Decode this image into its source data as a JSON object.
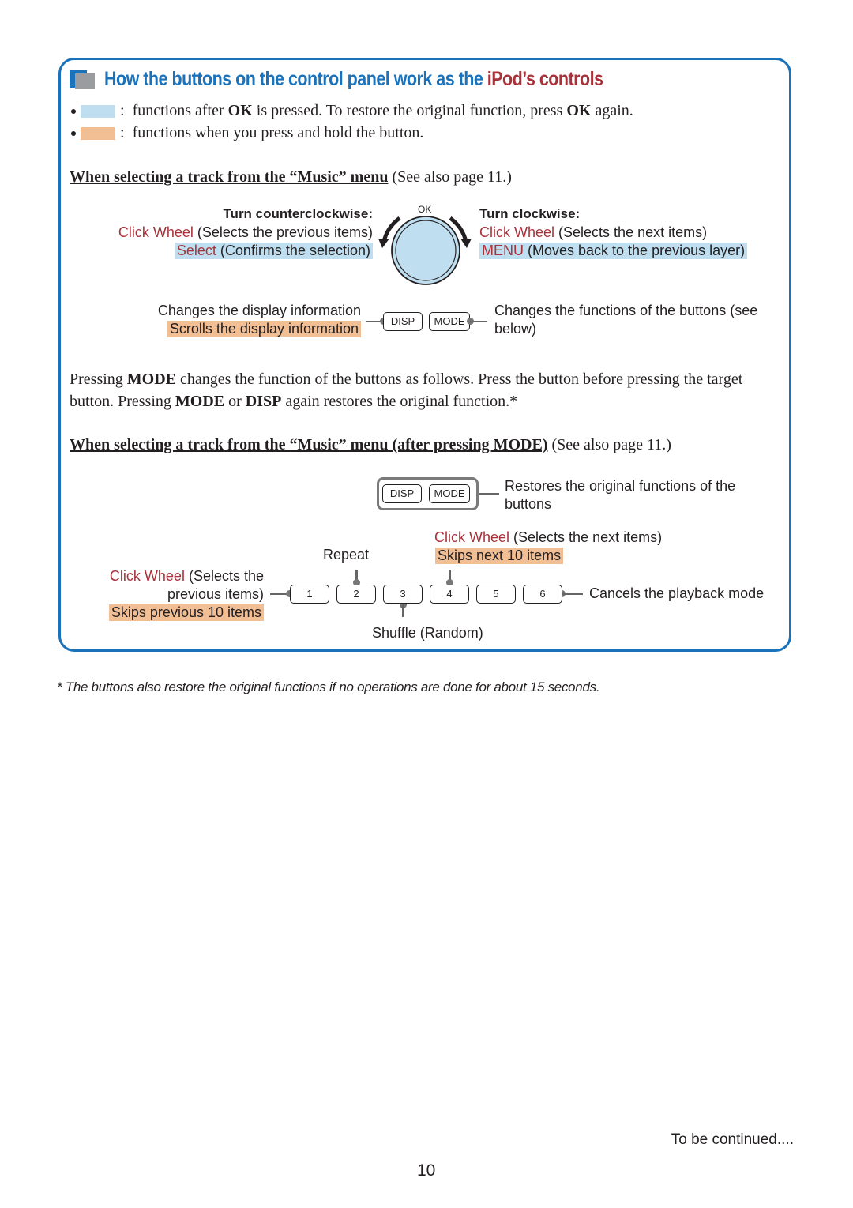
{
  "title": {
    "part1": "How the buttons on the control panel work as the ",
    "part2": "iPod’s controls"
  },
  "legend": [
    {
      "color": "#bfdff0",
      "sep": ":",
      "text_a": "functions after ",
      "bold": "OK",
      "text_b": " is pressed. To restore the original function, press ",
      "bold2": "OK",
      "text_c": " again."
    },
    {
      "color": "#f2bf95",
      "sep": ":",
      "text_a": "functions when you press and hold the button."
    }
  ],
  "section1": {
    "heading": "When selecting a track from the “Music” menu",
    "see_also": "(See also page 11.)"
  },
  "wheel": {
    "ok_label": "OK",
    "ccw": {
      "heading": "Turn counterclockwise:",
      "line1_red": "Click Wheel",
      "line1": " (Selects the previous items)",
      "line2_red": "Select",
      "line2": " (Confirms the selection)"
    },
    "cw": {
      "heading": "Turn clockwise:",
      "line1_red": "Click Wheel",
      "line1": " (Selects the next items)",
      "line2_red": "MENU",
      "line2": " (Moves back to the previous layer)"
    }
  },
  "disp_mode": {
    "disp": "DISP",
    "mode": "MODE",
    "left_line1": "Changes the display information",
    "left_line2": "Scrolls the display information",
    "right_line1": "Changes the functions of the buttons (see",
    "right_line2": "below)"
  },
  "paragraph": {
    "t1": "Pressing ",
    "b1": "MODE",
    "t2": " changes the function of the buttons as follows. Press the button before pressing the target button. Pressing ",
    "b2": "MODE",
    "t3": " or ",
    "b3": "DISP",
    "t4": " again restores the original function.*"
  },
  "section2": {
    "heading": "When selecting a track from the “Music” menu (after pressing MODE)",
    "see_also": "(See also page 11.)"
  },
  "mode_diagram": {
    "disp": "DISP",
    "mode": "MODE",
    "restore_line1": "Restores the original functions of the",
    "restore_line2": "buttons",
    "next_red": "Click Wheel",
    "next": " (Selects the next items)",
    "skip_next": "Skips next 10 items",
    "repeat": "Repeat",
    "prev_red": "Click Wheel",
    "prev_1": " (Selects the",
    "prev_2": "previous items)",
    "skip_prev": "Skips previous 10 items",
    "cancel": "Cancels the playback mode",
    "shuffle": "Shuffle (Random)",
    "buttons": [
      "1",
      "2",
      "3",
      "4",
      "5",
      "6"
    ]
  },
  "footnote": "*  The buttons also restore the original functions if no operations are done for about 15 seconds.",
  "continued": "To be continued....",
  "page_number": "10"
}
